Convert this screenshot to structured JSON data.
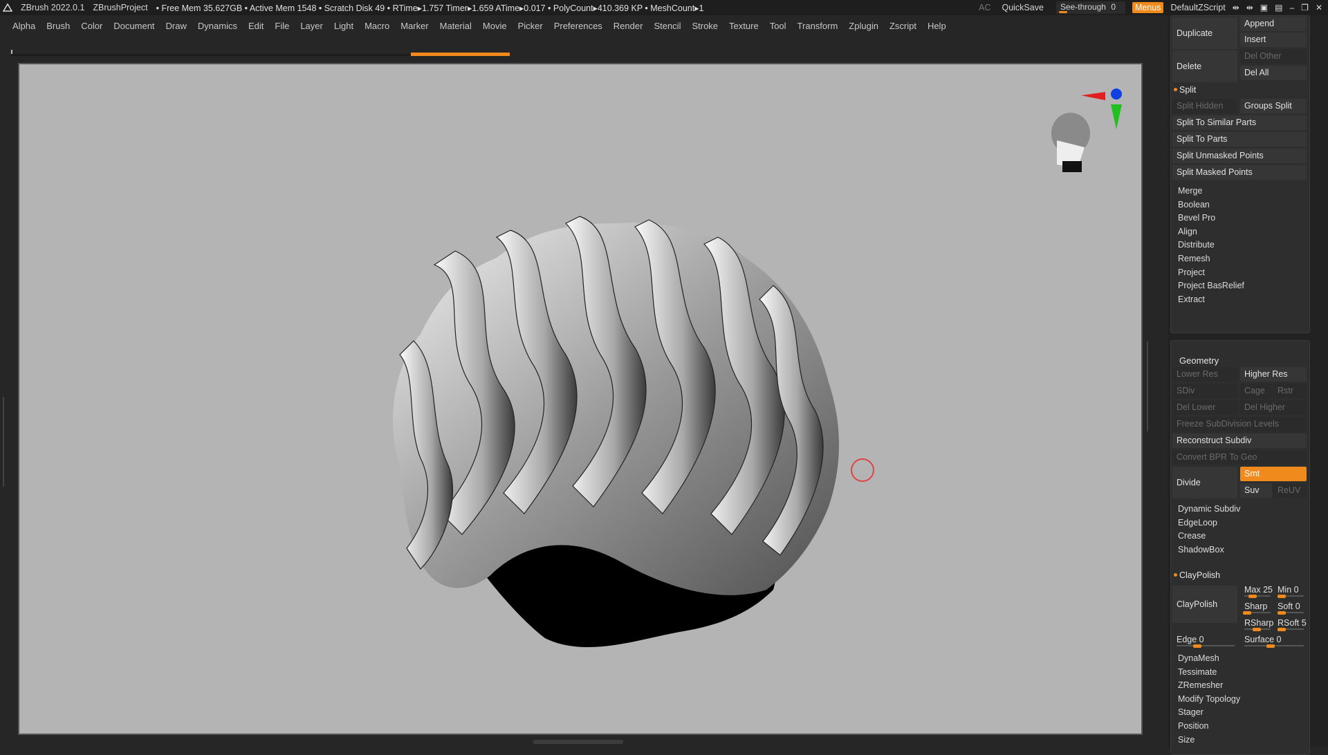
{
  "titlebar": {
    "app": "ZBrush 2022.0.1",
    "project": "ZBrushProject",
    "stats": "• Free Mem 35.627GB • Active Mem 1548 • Scratch Disk 49 •  RTime▸1.757 Timer▸1.659 ATime▸0.017 • PolyCount▸410.369 KP  • MeshCount▸1",
    "ac": "AC",
    "quicksave": "QuickSave",
    "see_through_label": "See-through",
    "see_through_value": "0",
    "menus": "Menus",
    "script": "DefaultZScript",
    "see_through_fill": 0
  },
  "menubar": [
    "Alpha",
    "Brush",
    "Color",
    "Document",
    "Draw",
    "Dynamics",
    "Edit",
    "File",
    "Layer",
    "Light",
    "Macro",
    "Marker",
    "Material",
    "Movie",
    "Picker",
    "Preferences",
    "Render",
    "Stencil",
    "Stroke",
    "Texture",
    "Tool",
    "Transform",
    "Zplugin",
    "Zscript",
    "Help"
  ],
  "panel": {
    "duplicate": "Duplicate",
    "append": "Append",
    "insert": "Insert",
    "delete": "Delete",
    "del_other": "Del Other",
    "del_all": "Del All",
    "split": "Split",
    "split_hidden": "Split Hidden",
    "groups_split": "Groups Split",
    "split_similar": "Split To Similar Parts",
    "split_parts": "Split To Parts",
    "split_unmasked": "Split Unmasked Points",
    "split_masked": "Split Masked Points",
    "subtool_items": [
      "Merge",
      "Boolean",
      "Bevel Pro",
      "Align",
      "Distribute",
      "Remesh",
      "Project",
      "Project BasRelief",
      "Extract"
    ],
    "geometry": "Geometry",
    "lower_res": "Lower Res",
    "higher_res": "Higher Res",
    "sdiv": "SDiv",
    "cage": "Cage",
    "rstr": "Rstr",
    "del_lower": "Del Lower",
    "del_higher": "Del Higher",
    "freeze_sdiv": "Freeze SubDivision Levels",
    "reconstruct": "Reconstruct Subdiv",
    "convert_bpr": "Convert BPR To Geo",
    "divide": "Divide",
    "smt": "Smt",
    "suv": "Suv",
    "reuv": "ReUV",
    "geo_items_a": [
      "Dynamic Subdiv",
      "EdgeLoop",
      "Crease",
      "ShadowBox"
    ],
    "claypolish": "ClayPolish",
    "claypolish_btn": "ClayPolish",
    "max": "Max 25",
    "min": "Min 0",
    "sharp": "Sharp",
    "soft": "Soft 0",
    "rsharp": "RSharp",
    "rsoft": "RSoft 5",
    "edge": "Edge 0",
    "surface": "Surface 0",
    "geo_items_b": [
      "DynaMesh",
      "Tessimate",
      "ZRemesher",
      "Modify Topology",
      "Stager",
      "Position",
      "Size"
    ]
  },
  "icons": {
    "zlogo": "zbrush-logo-icon",
    "gizmo": "transpose-gizmo-icon",
    "axis": "navigation-axis-icon",
    "cursor": "brush-cursor-icon"
  },
  "colors": {
    "accent": "#f08a1c",
    "viewport_bg": "#b4b4b4",
    "axis_x": "#e02020",
    "axis_y": "#20c020",
    "axis_z": "#1040e0"
  }
}
